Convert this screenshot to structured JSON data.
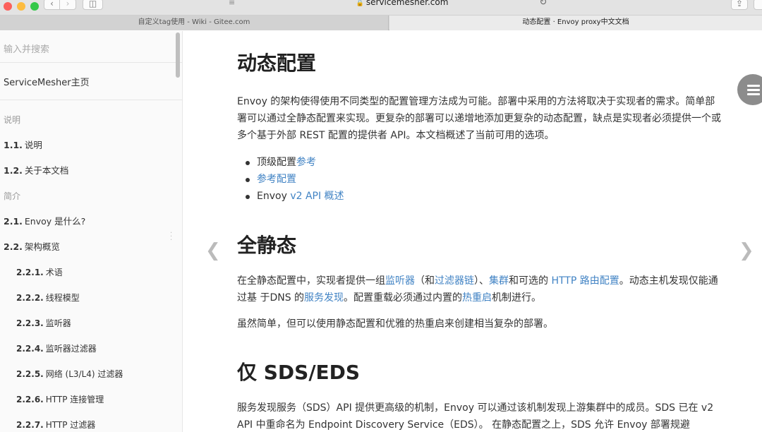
{
  "browser": {
    "url": "servicemesher.com",
    "tabs": [
      {
        "title": "自定义tag使用 - Wiki - Gitee.com"
      },
      {
        "title": "动态配置 · Envoy proxy中文文档"
      }
    ],
    "icons": {
      "back": "chevron-left-icon",
      "forward": "chevron-right-icon",
      "sidebar": "sidebar-icon",
      "reader": "reader-icon",
      "lock": "lock-icon",
      "reload": "reload-icon",
      "share": "share-icon"
    }
  },
  "sidebar": {
    "search_placeholder": "输入并搜索",
    "home": "ServiceMesher主页",
    "sections": [
      {
        "header": "说明",
        "items": [
          {
            "num": "1.1.",
            "label": "说明"
          },
          {
            "num": "1.2.",
            "label": "关于本文档"
          }
        ]
      },
      {
        "header": "简介",
        "items": [
          {
            "num": "2.1.",
            "label": "Envoy 是什么?"
          },
          {
            "num": "2.2.",
            "label": "架构概览"
          },
          {
            "num": "2.2.1.",
            "label": "术语"
          },
          {
            "num": "2.2.2.",
            "label": "线程模型"
          },
          {
            "num": "2.2.3.",
            "label": "监听器"
          },
          {
            "num": "2.2.4.",
            "label": "监听器过滤器"
          },
          {
            "num": "2.2.5.",
            "label": "网络 (L3/L4) 过滤器"
          },
          {
            "num": "2.2.6.",
            "label": "HTTP 连接管理"
          },
          {
            "num": "2.2.7.",
            "label": "HTTP 过滤器"
          }
        ]
      }
    ]
  },
  "content": {
    "title": "动态配置",
    "intro": "Envoy 的架构使得使用不同类型的配置管理方法成为可能。部署中采用的方法将取决于实现者的需求。简单部署可以通过全静态配置来实现。更复杂的部署可以递增地添加更复杂的动态配置，缺点是实现者必须提供一个或多个基于外部 REST 配置的提供者 API。本文档概述了当前可用的选项。",
    "bullets": {
      "b1_text": "顶级配置",
      "b1_link": "参考",
      "b2_link": "参考配置",
      "b3_text": "Envoy ",
      "b3_link": "v2 API 概述"
    },
    "static_heading": "全静态",
    "static_para": {
      "s1": "在全静态配置中，实现者提供一组",
      "l1": "监听器",
      "s2": "（和",
      "l2": "过滤器链",
      "s3": "）、",
      "l3": "集群",
      "s4": "和可选的 ",
      "l4": "HTTP 路由配置",
      "s5": "。动态主机发现仅能通过基 于DNS 的",
      "l5": "服务发现",
      "s6": "。配置重载必须通过内置的",
      "l6": "热重启",
      "s7": "机制进行。"
    },
    "static_para2": "虽然简单，但可以使用静态配置和优雅的热重启来创建相当复杂的部署。",
    "sds_heading": "仅 SDS/EDS",
    "sds_para": "服务发现服务（SDS）API 提供更高级的机制，Envoy 可以通过该机制发现上游集群中的成员。SDS 已在 v2 API 中重命名为 Endpoint Discovery Service（EDS）。 在静态配置之上，SDS 允许 Envoy 部署规避"
  },
  "nav": {
    "prev_icon": "chevron-left-icon",
    "next_icon": "chevron-right-icon",
    "menu_icon": "hamburger-menu-icon"
  },
  "colors": {
    "link": "#4183c4",
    "traffic_red": "#fc605b",
    "traffic_yellow": "#fdbc40",
    "traffic_green": "#34c84a"
  }
}
